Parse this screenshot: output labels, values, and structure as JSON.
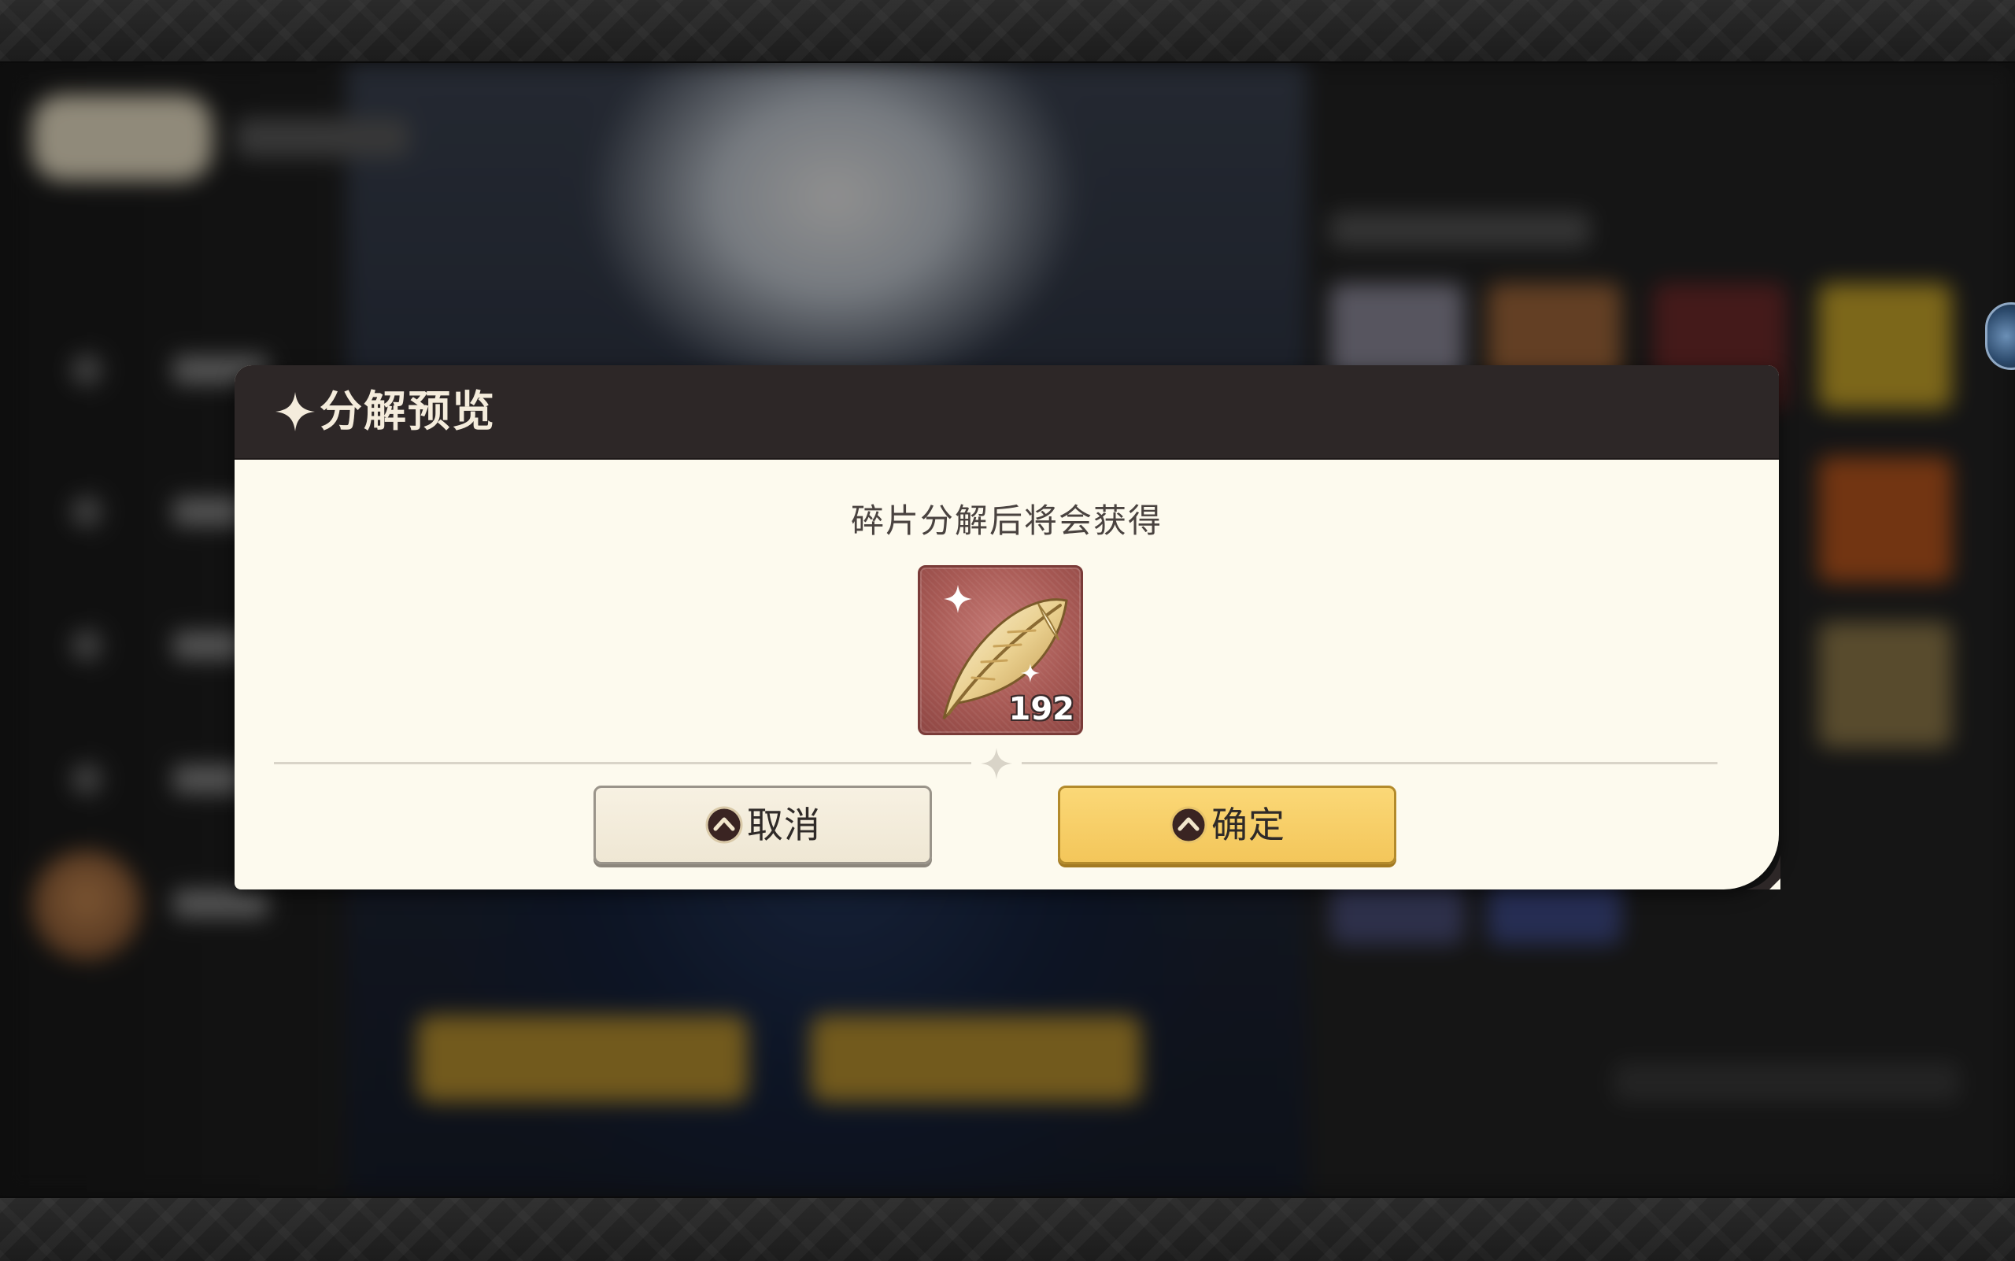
{
  "dialog": {
    "title": "分解预览",
    "message": "碎片分解后将会获得",
    "reward": {
      "icon": "golden-feather-icon",
      "count": "192"
    },
    "buttons": {
      "cancel_label": "取消",
      "confirm_label": "确定"
    }
  },
  "colors": {
    "header_bg": "#2d2727",
    "dialog_bg": "#fdfaee",
    "confirm_bg": "#f3c65a",
    "cancel_bg": "#efe7d4",
    "item_bg": "#a85a55"
  }
}
